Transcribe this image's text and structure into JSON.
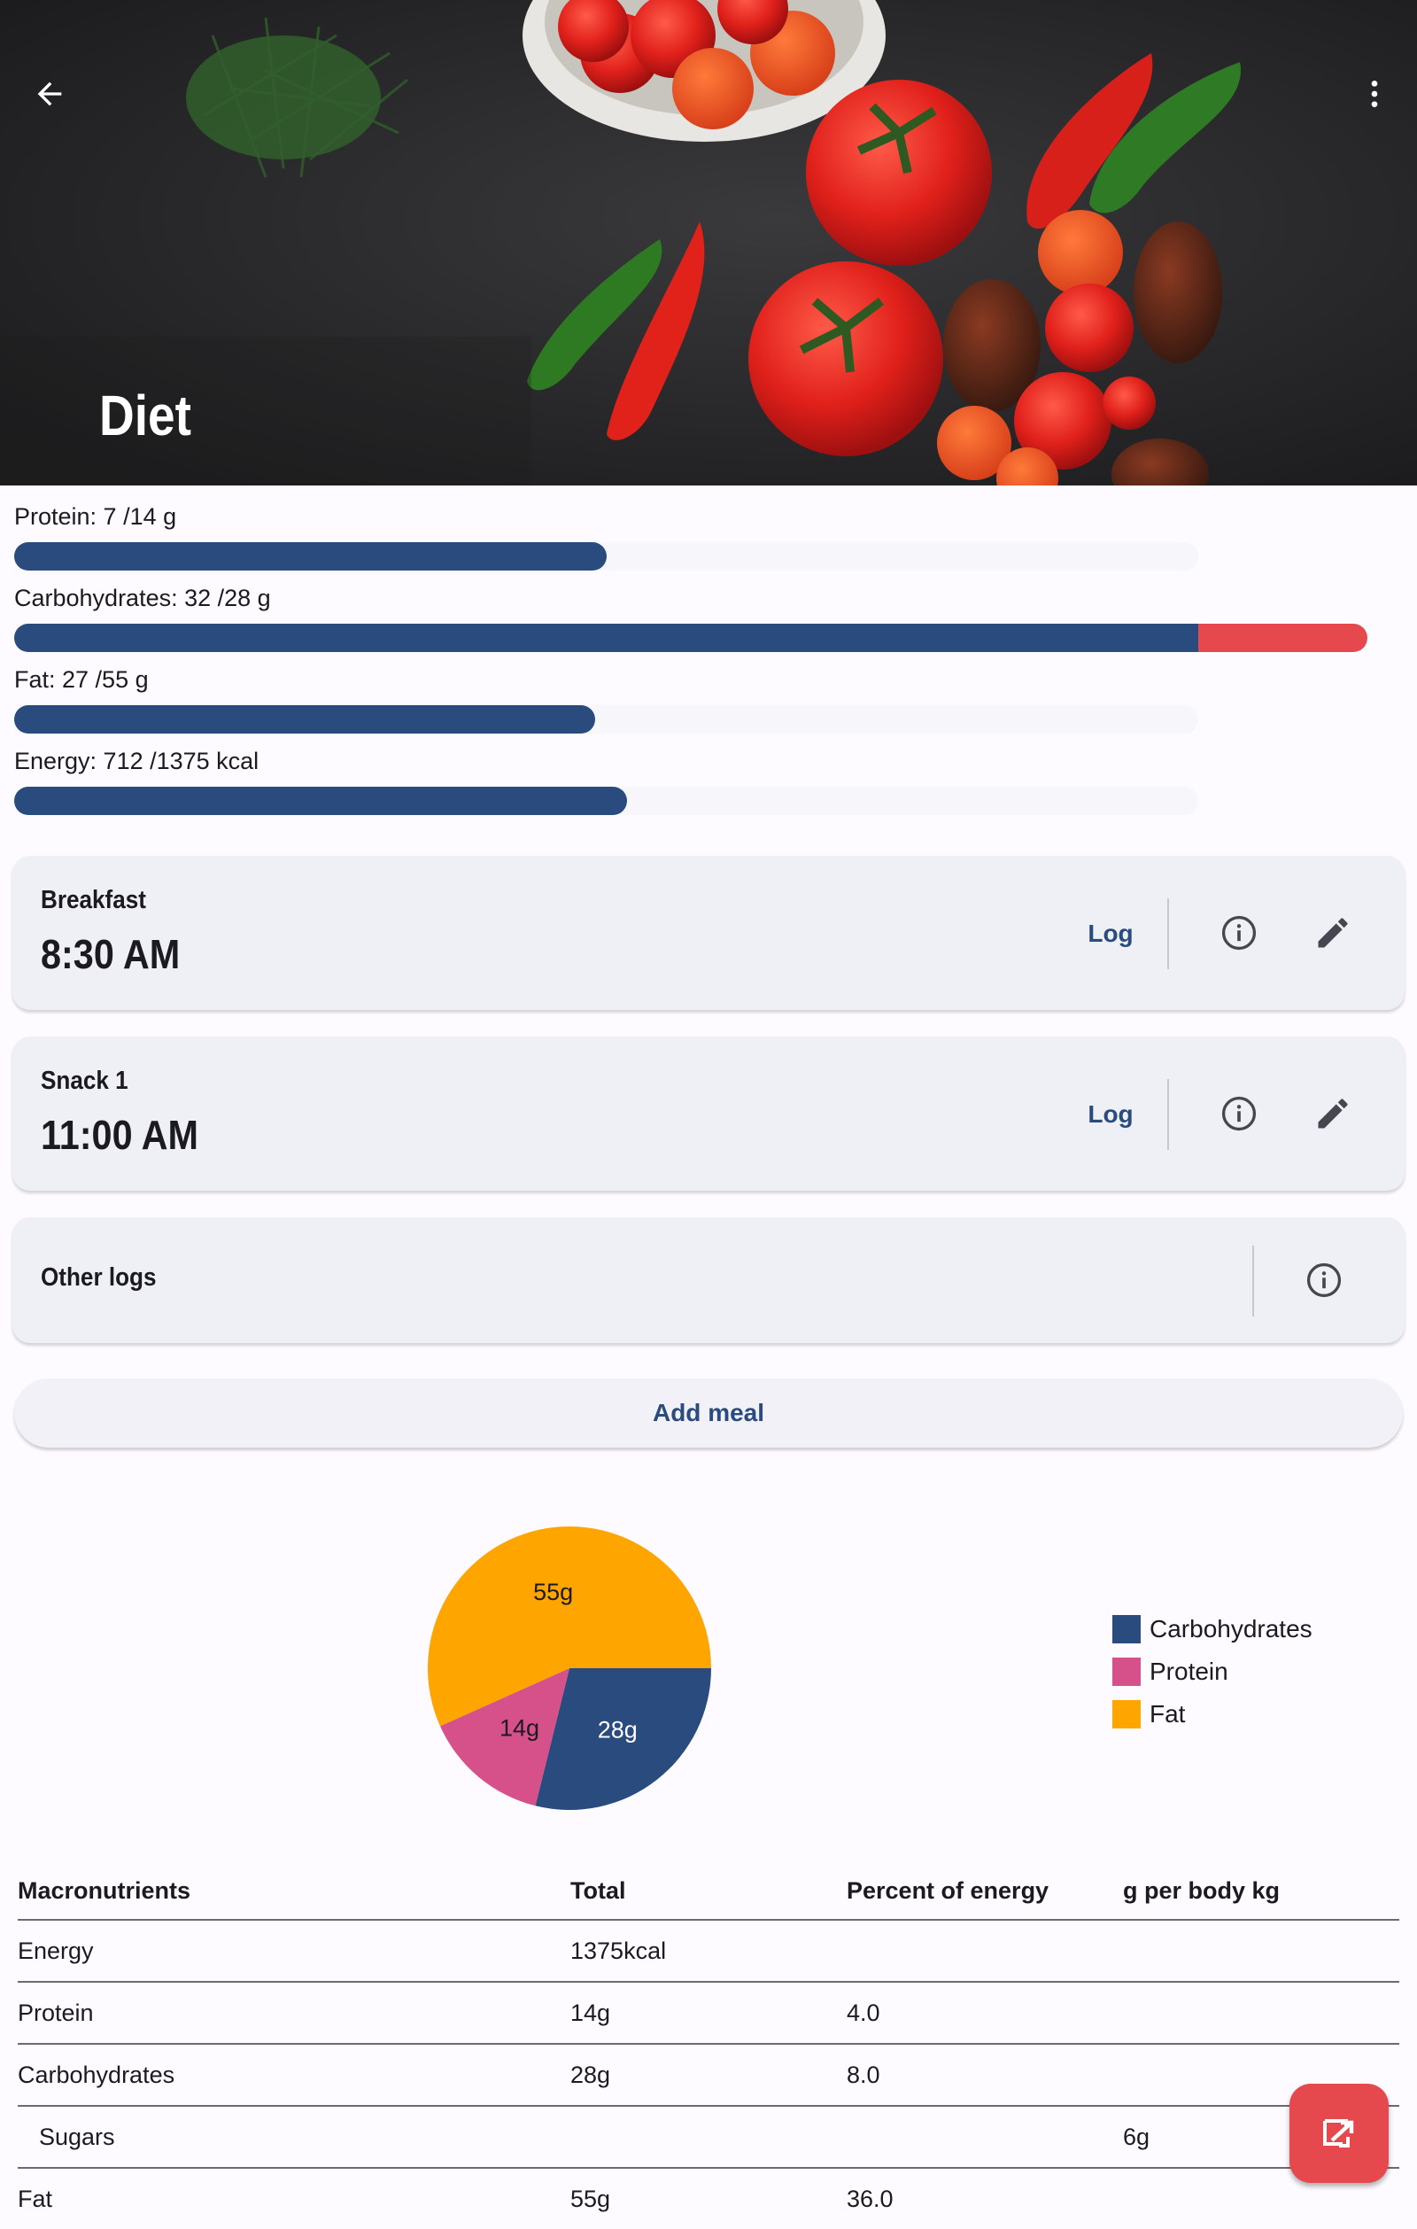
{
  "app": {
    "title": "Diet",
    "back_icon": "arrow-back-icon",
    "menu_icon": "more-vert-icon"
  },
  "progress": [
    {
      "label": "Protein: 7 /14 g",
      "value": 7,
      "target": 14
    },
    {
      "label": "Carbohydrates: 32 /28 g",
      "value": 32,
      "target": 28
    },
    {
      "label": "Fat: 27 /55 g",
      "value": 27,
      "target": 55
    },
    {
      "label": "Energy: 712 /1375 kcal",
      "value": 712,
      "target": 1375
    }
  ],
  "meals": [
    {
      "name": "Breakfast",
      "time": "8:30 AM",
      "log_label": "Log"
    },
    {
      "name": "Snack 1",
      "time": "11:00 AM",
      "log_label": "Log"
    }
  ],
  "other_logs": {
    "label": "Other logs"
  },
  "add_meal_label": "Add meal",
  "colors": {
    "primary": "#294b7e",
    "over": "#e5484d",
    "carbohydrates": "#294b7e",
    "protein": "#d6508a",
    "fat": "#ffa500"
  },
  "chart_data": {
    "type": "pie",
    "slices": [
      {
        "name": "Carbohydrates",
        "value": 28,
        "label": "28g",
        "color": "#294b7e"
      },
      {
        "name": "Protein",
        "value": 14,
        "label": "14g",
        "color": "#d6508a"
      },
      {
        "name": "Fat",
        "value": 55,
        "label": "55g",
        "color": "#ffa500"
      }
    ],
    "legend": [
      "Carbohydrates",
      "Protein",
      "Fat"
    ],
    "legend_position": "right"
  },
  "table": {
    "headers": [
      "Macronutrients",
      "Total",
      "Percent of energy",
      "g per body kg"
    ],
    "rows": [
      [
        "Energy",
        "1375kcal",
        "",
        ""
      ],
      [
        "Protein",
        "14g",
        "4.0",
        ""
      ],
      [
        "Carbohydrates",
        "28g",
        "8.0",
        ""
      ],
      [
        "Sugars",
        "",
        "",
        "6g"
      ],
      [
        "Fat",
        "55g",
        "36.0",
        ""
      ]
    ]
  }
}
